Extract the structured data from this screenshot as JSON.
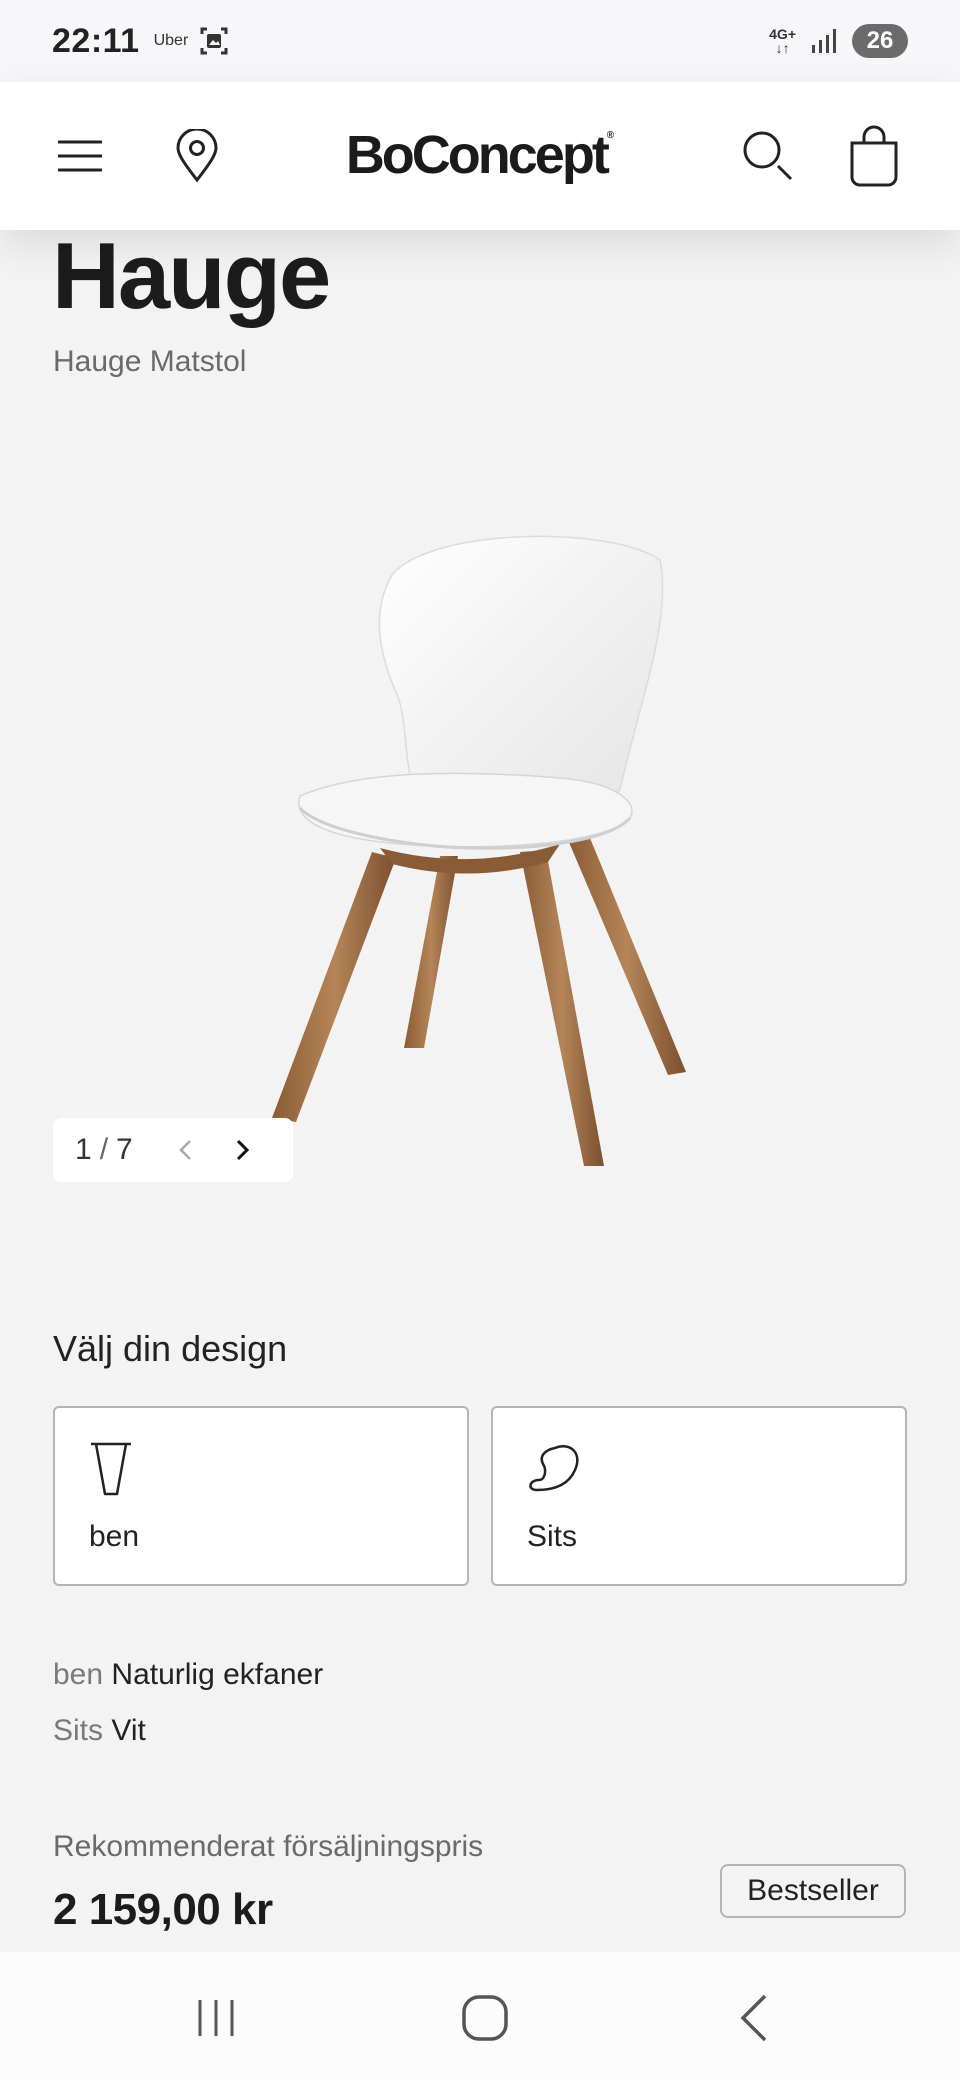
{
  "status_bar": {
    "time": "22:11",
    "app": "Uber",
    "network_top": "4G+",
    "network_bottom": "↓↑",
    "battery": "26",
    "icons": [
      "gallery-icon",
      "signal-icon",
      "battery-icon"
    ]
  },
  "header": {
    "brand": "BoConcept",
    "brand_mark": "®",
    "icons": [
      "menu-icon",
      "location-pin-icon",
      "search-icon",
      "shopping-bag-icon"
    ]
  },
  "product": {
    "name": "Hauge",
    "subtitle": "Hauge Matstol",
    "image": "white-chair-with-oak-legs",
    "gallery": {
      "current": "1",
      "separator": "/",
      "total": "7"
    }
  },
  "design": {
    "title": "Välj din design",
    "options": [
      {
        "label": "ben",
        "icon": "chair-leg-icon"
      },
      {
        "label": "Sits",
        "icon": "chair-seat-icon"
      }
    ]
  },
  "specs": [
    {
      "key": "ben",
      "value": "Naturlig ekfaner"
    },
    {
      "key": "Sits",
      "value": "Vit"
    }
  ],
  "price": {
    "label": "Rekommenderat försäljningspris",
    "value": "2 159,00 kr",
    "badge": "Bestseller"
  },
  "nav": {
    "icons": [
      "recent-apps-icon",
      "home-icon",
      "back-icon"
    ]
  }
}
